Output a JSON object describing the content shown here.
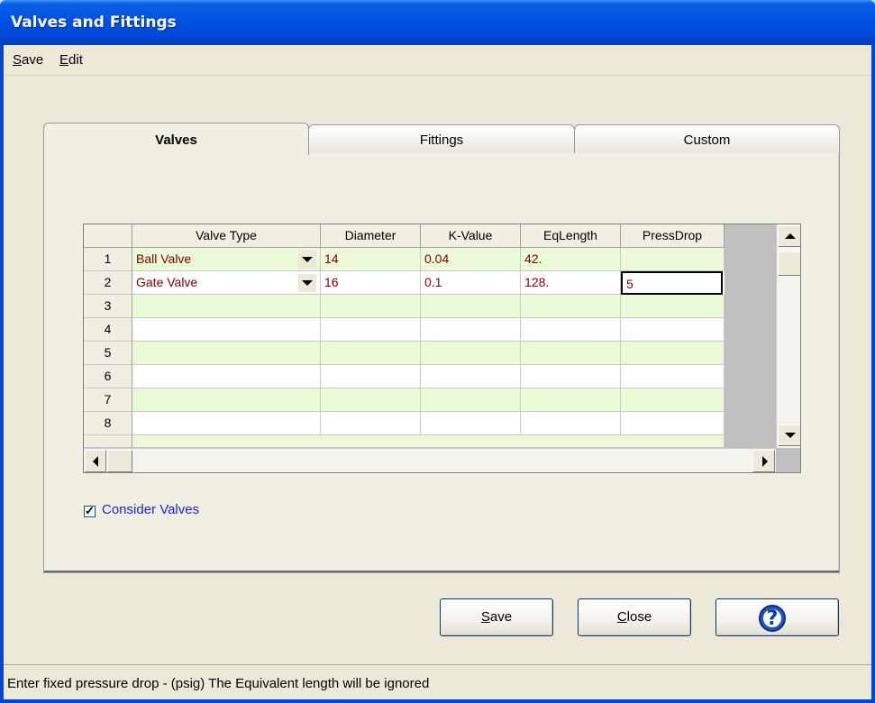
{
  "window": {
    "title": "Valves and Fittings"
  },
  "menu": [
    {
      "label": "Save",
      "accel": "S",
      "rest": "ave"
    },
    {
      "label": "Edit",
      "accel": "E",
      "rest": "dit"
    }
  ],
  "tabs": [
    {
      "label": "Valves",
      "active": true
    },
    {
      "label": "Fittings",
      "active": false
    },
    {
      "label": "Custom",
      "active": false
    }
  ],
  "grid": {
    "columns": [
      "Valve Type",
      "Diameter",
      "K-Value",
      "EqLength",
      "PressDrop"
    ],
    "rows": [
      {
        "num": "1",
        "valve_type": "Ball Valve",
        "diameter": "14",
        "k_value": "0.04",
        "eq_length": "42.",
        "press_drop": ""
      },
      {
        "num": "2",
        "valve_type": "Gate Valve",
        "diameter": "16",
        "k_value": "0.1",
        "eq_length": "128.",
        "press_drop": "5"
      },
      {
        "num": "3",
        "valve_type": "",
        "diameter": "",
        "k_value": "",
        "eq_length": "",
        "press_drop": ""
      },
      {
        "num": "4",
        "valve_type": "",
        "diameter": "",
        "k_value": "",
        "eq_length": "",
        "press_drop": ""
      },
      {
        "num": "5",
        "valve_type": "",
        "diameter": "",
        "k_value": "",
        "eq_length": "",
        "press_drop": ""
      },
      {
        "num": "6",
        "valve_type": "",
        "diameter": "",
        "k_value": "",
        "eq_length": "",
        "press_drop": ""
      },
      {
        "num": "7",
        "valve_type": "",
        "diameter": "",
        "k_value": "",
        "eq_length": "",
        "press_drop": ""
      },
      {
        "num": "8",
        "valve_type": "",
        "diameter": "",
        "k_value": "",
        "eq_length": "",
        "press_drop": ""
      }
    ]
  },
  "consider_valves": {
    "label": "Consider Valves",
    "checked": true
  },
  "buttons": {
    "save": {
      "accel": "S",
      "rest": "ave"
    },
    "close": {
      "accel": "C",
      "rest": "lose"
    },
    "help_icon": "help-question-icon"
  },
  "status": "Enter fixed pressure drop - (psig)  The Equivalent length will be ignored",
  "colors": {
    "title_bar": "#0054e3",
    "row_alt": "#eafad6",
    "cell_value": "#800000",
    "checkbox_label": "#2020e0"
  }
}
